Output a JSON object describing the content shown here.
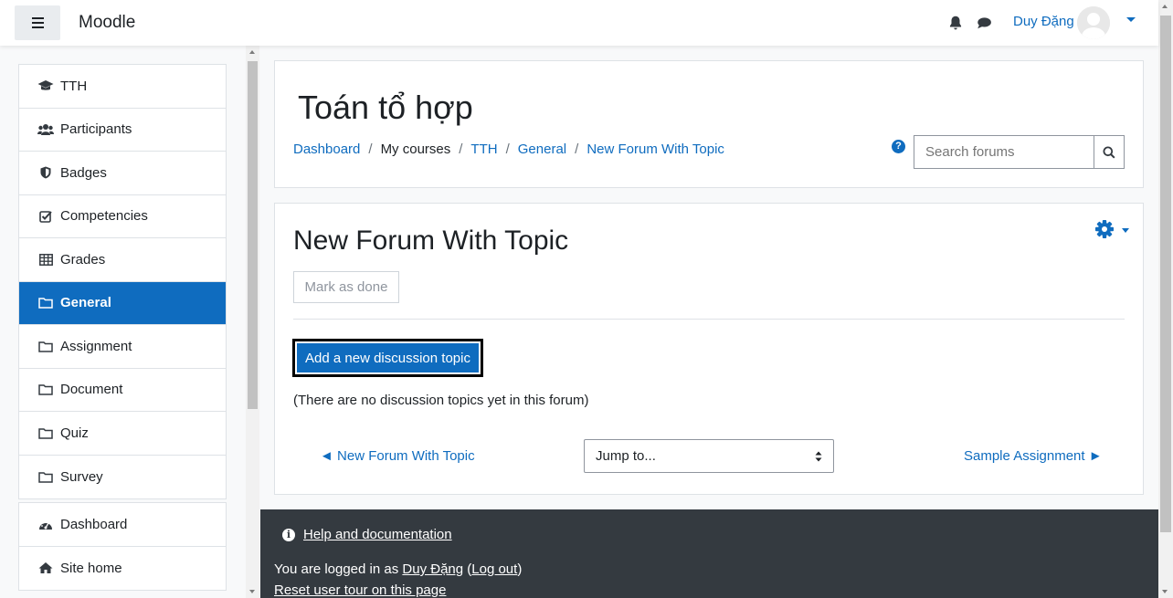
{
  "navbar": {
    "brand": "Moodle",
    "user_name": "Duy Đặng"
  },
  "drawer": {
    "course_nav": [
      {
        "label": "TTH",
        "icon": "graduation-cap-icon"
      },
      {
        "label": "Participants",
        "icon": "users-icon"
      },
      {
        "label": "Badges",
        "icon": "shield-icon"
      },
      {
        "label": "Competencies",
        "icon": "check-square-icon"
      },
      {
        "label": "Grades",
        "icon": "table-icon"
      },
      {
        "label": "General",
        "icon": "folder-icon",
        "active": true
      },
      {
        "label": "Assignment",
        "icon": "folder-icon"
      },
      {
        "label": "Document",
        "icon": "folder-icon"
      },
      {
        "label": "Quiz",
        "icon": "folder-icon"
      },
      {
        "label": "Survey",
        "icon": "folder-icon"
      }
    ],
    "site_nav": [
      {
        "label": "Dashboard",
        "icon": "dashboard-icon"
      },
      {
        "label": "Site home",
        "icon": "home-icon"
      }
    ]
  },
  "header": {
    "course_title": "Toán tổ hợp",
    "breadcrumb": [
      "Dashboard",
      "My courses",
      "TTH",
      "General",
      "New Forum With Topic"
    ],
    "search_placeholder": "Search forums"
  },
  "forum": {
    "title": "New Forum With Topic",
    "mark_done_label": "Mark as done",
    "add_topic_label": "Add a new discussion topic",
    "no_topics_text": "(There are no discussion topics yet in this forum)",
    "prev_activity": "◄ New Forum With Topic",
    "jump_to": "Jump to...",
    "next_activity": "Sample Assignment ►"
  },
  "footer": {
    "help_label": "Help and documentation",
    "logged_in_prefix": "You are logged in as ",
    "logged_in_user": "Duy Đặng",
    "logout_label": "Log out",
    "reset_tour_label": "Reset user tour on this page"
  },
  "colors": {
    "accent": "#0f6cbf",
    "footer_bg": "#343a40",
    "drawer_bg": "#f8f9fa"
  }
}
